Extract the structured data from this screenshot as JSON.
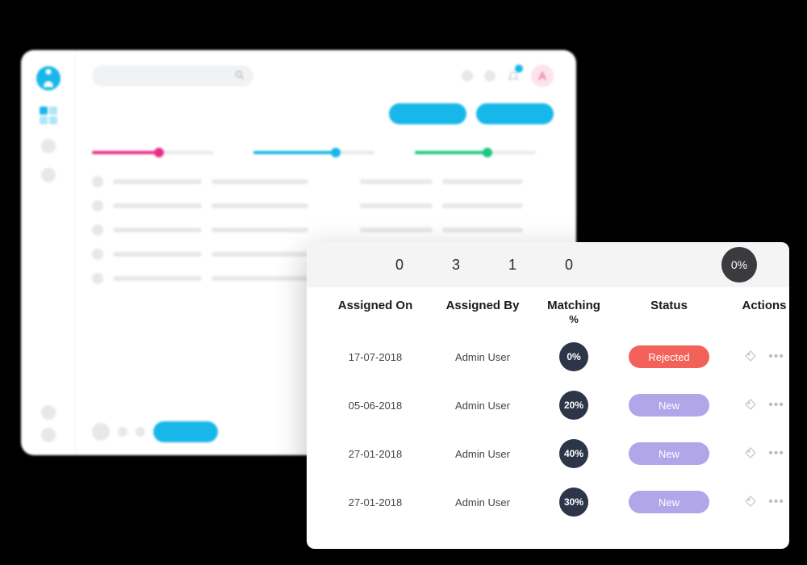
{
  "dashboard": {
    "avatar_letter": "A",
    "search_placeholder": ""
  },
  "table": {
    "stats": [
      "0",
      "3",
      "1",
      "0"
    ],
    "stats_pill": "0%",
    "columns": {
      "assigned_on": "Assigned On",
      "assigned_by": "Assigned By",
      "matching": "Matching",
      "matching_sub": "%",
      "status": "Status",
      "actions": "Actions"
    },
    "rows": [
      {
        "assigned_on": "17-07-2018",
        "assigned_by": "Admin User",
        "matching": "0%",
        "status": "Rejected",
        "status_class": "rejected"
      },
      {
        "assigned_on": "05-06-2018",
        "assigned_by": "Admin User",
        "matching": "20%",
        "status": "New",
        "status_class": "new"
      },
      {
        "assigned_on": "27-01-2018",
        "assigned_by": "Admin User",
        "matching": "40%",
        "status": "New",
        "status_class": "new"
      },
      {
        "assigned_on": "27-01-2018",
        "assigned_by": "Admin User",
        "matching": "30%",
        "status": "New",
        "status_class": "new"
      }
    ]
  }
}
